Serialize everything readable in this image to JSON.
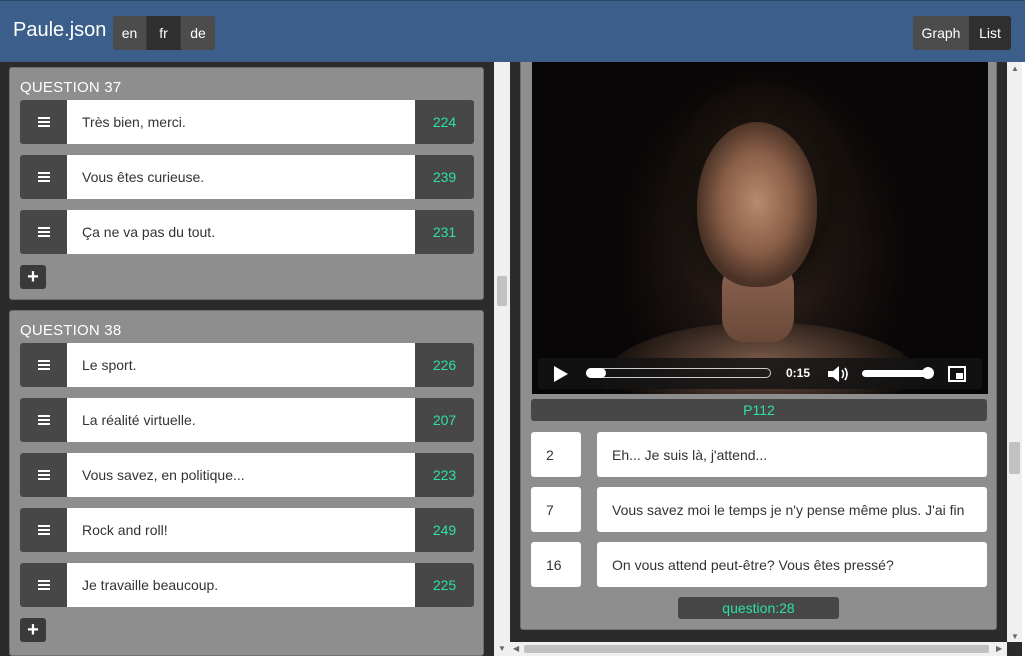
{
  "app": {
    "title": "Paule.json"
  },
  "languages": [
    {
      "label": "en",
      "active": false
    },
    {
      "label": "fr",
      "active": true
    },
    {
      "label": "de",
      "active": false
    }
  ],
  "view_toggle": {
    "graph_label": "Graph",
    "list_label": "List",
    "active": "List"
  },
  "questions": [
    {
      "title": "QUESTION 37",
      "answers": [
        {
          "text": "Très bien, merci.",
          "target": "224"
        },
        {
          "text": "Vous êtes curieuse.",
          "target": "239"
        },
        {
          "text": "Ça ne va pas du tout.",
          "target": "231"
        }
      ],
      "add_label": "+"
    },
    {
      "title": "QUESTION 38",
      "answers": [
        {
          "text": "Le sport.",
          "target": "226"
        },
        {
          "text": "La réalité virtuelle.",
          "target": "207"
        },
        {
          "text": "Vous savez, en politique...",
          "target": "223"
        },
        {
          "text": "Rock and roll!",
          "target": "249"
        },
        {
          "text": "Je travaille beaucoup.",
          "target": "225"
        }
      ],
      "add_label": "+"
    }
  ],
  "player": {
    "timecode": "0:15",
    "progress": 0.0,
    "volume": 0.95
  },
  "detail": {
    "id": "P112",
    "links": [
      {
        "num": "2",
        "text": "Eh... Je suis là, j'attend..."
      },
      {
        "num": "7",
        "text": "Vous savez moi le temps je n'y pense même plus. J'ai fin"
      },
      {
        "num": "16",
        "text": "On vous attend peut-être? Vous êtes pressé?"
      }
    ],
    "question_link": "question:28"
  },
  "icons": {
    "handle": "drag-handle-icon",
    "add": "plus-icon",
    "play": "play-icon",
    "volume": "volume-icon",
    "fullscreen": "fullscreen-icon"
  },
  "colors": {
    "topbar": "#3b5f8a",
    "accent": "#2de0a6",
    "card": "#8e8e8e",
    "dark": "#474747"
  }
}
